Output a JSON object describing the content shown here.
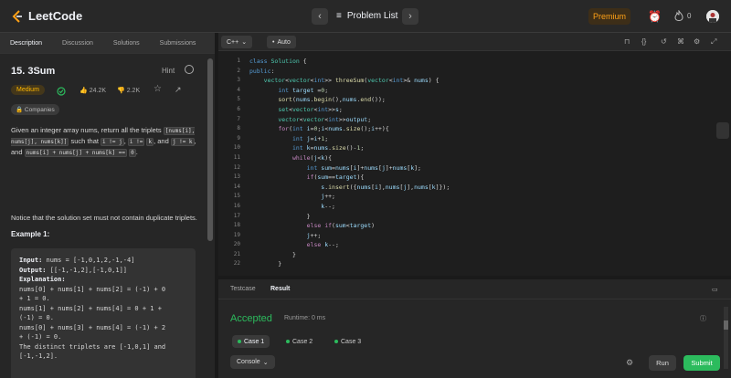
{
  "topbar": {
    "brand": "LeetCode",
    "nav_prev": "‹",
    "problem_list_icon": "≡",
    "problem_list": "Problem List",
    "nav_next": "›",
    "premium": "Premium",
    "streak_count": "0",
    "icons": [
      "alarm-clock-icon",
      "flame-icon",
      "avatar"
    ]
  },
  "left_tabs": [
    "Description",
    "Discussion",
    "Solutions",
    "Submissions"
  ],
  "problem": {
    "title": "15. 3Sum",
    "hint": "Hint",
    "difficulty": "Medium",
    "likes": "24.2K",
    "dislikes": "2.2K",
    "companies": "Companies",
    "desc_p1": "Given an integer array nums, return all the triplets",
    "desc_code1": "[nums[i], nums[j], nums[k]]",
    "desc_p1b": "such that",
    "desc_code2": "i != j",
    "desc_p1c": ",",
    "desc_code3": "i !=",
    "desc_code3b": "k",
    "desc_p1d": ", and",
    "desc_code4": "j != k",
    "desc_p1e": ", and",
    "desc_code5": "nums[i] + nums[j] + nums[k] ==",
    "desc_code5b": "0",
    "desc_p1f": ".",
    "desc_p2": "Notice that the solution set must not contain duplicate triplets.",
    "example_title": "Example 1:",
    "example": {
      "input_label": "Input:",
      "input": "nums = [-1,0,1,2,-1,-4]",
      "output_label": "Output:",
      "output": "[[-1,-1,2],[-1,0,1]]",
      "explanation_label": "Explanation:",
      "lines": [
        "nums[0] + nums[1] + nums[2] = (-1) + 0",
        "+ 1 = 0.",
        "nums[1] + nums[2] + nums[4] = 0 + 1 +",
        "(-1) = 0.",
        "nums[0] + nums[3] + nums[4] = (-1) + 2",
        "+ (-1) = 0.",
        "The distinct triplets are [-1,0,1] and",
        "[-1,-1,2]."
      ]
    }
  },
  "editor": {
    "language": "C++",
    "mode": "Auto",
    "line_numbers": [
      "1",
      "2",
      "3",
      "4",
      "5",
      "6",
      "7",
      "8",
      "9",
      "10",
      "11",
      "12",
      "13",
      "14",
      "15",
      "16",
      "17",
      "18",
      "19",
      "20",
      "21",
      "22"
    ]
  },
  "bottom": {
    "tabs": [
      "Testcase",
      "Result"
    ],
    "status": "Accepted",
    "runtime": "Runtime: 0 ms",
    "cases": [
      "Case 1",
      "Case 2",
      "Case 3"
    ],
    "console": "Console",
    "run": "Run",
    "submit": "Submit"
  },
  "colors": {
    "accent": "#ffa116",
    "accepted": "#2cbb5d",
    "medium": "#ffb800"
  }
}
